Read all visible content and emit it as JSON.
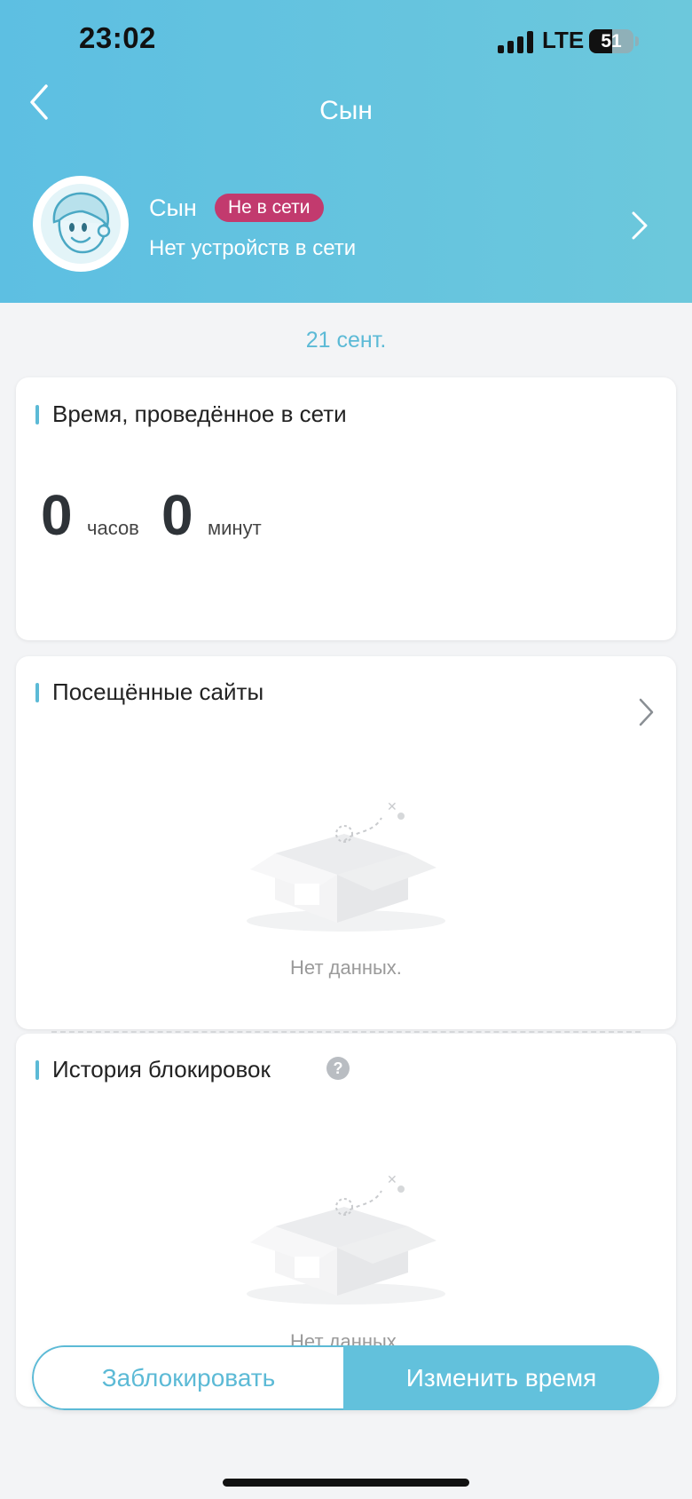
{
  "status_bar": {
    "time": "23:02",
    "network": "LTE",
    "battery": "51",
    "battery_level": 0.51
  },
  "header": {
    "title": "Сын",
    "back_icon": "chevron-left-icon"
  },
  "profile": {
    "name": "Сын",
    "status": "Не в сети",
    "subtitle": "Нет устройств в сети",
    "status_color": "#c23a6e"
  },
  "date": "21 сент.",
  "online_time": {
    "title": "Время, проведённое в сети",
    "hours": "0",
    "hours_unit": "часов",
    "minutes": "0",
    "minutes_unit": "минут"
  },
  "visited_sites": {
    "title": "Посещённые сайты",
    "empty_text": "Нет данных."
  },
  "block_history": {
    "title": "История блокировок",
    "help_icon": "question-icon",
    "empty_text": "Нет данных."
  },
  "actions": {
    "block_label": "Заблокировать",
    "change_time_label": "Изменить время"
  },
  "colors": {
    "accent": "#5cbad6",
    "header_gradient_start": "#5dbfe2",
    "header_gradient_end": "#6cc8dc"
  }
}
